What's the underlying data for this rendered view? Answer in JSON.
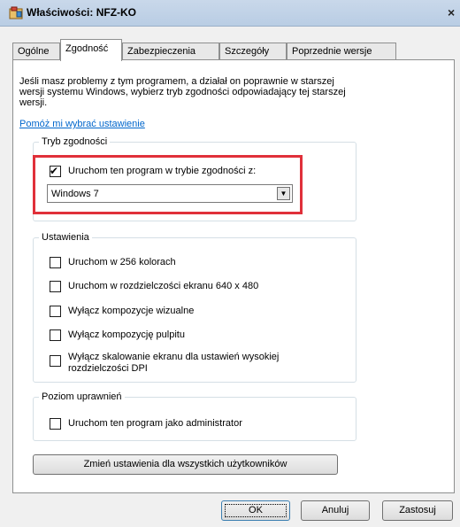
{
  "window": {
    "title": "Właściwości: NFZ-KO",
    "close_glyph": "×"
  },
  "tabs": [
    {
      "label": "Ogólne"
    },
    {
      "label": "Zgodność"
    },
    {
      "label": "Zabezpieczenia"
    },
    {
      "label": "Szczegóły"
    },
    {
      "label": "Poprzednie wersje"
    }
  ],
  "active_tab": "Zgodność",
  "description": "Jeśli masz problemy z tym programem, a działał on poprawnie w starszej wersji systemu Windows, wybierz tryb zgodności odpowiadający tej starszej wersji.",
  "help_link": "Pomóż mi wybrać ustawienie",
  "compat_mode": {
    "title": "Tryb zgodności",
    "checkbox_label": "Uruchom ten program w trybie zgodności z:",
    "checked": true,
    "select_value": "Windows 7",
    "highlight_color": "#e0303a"
  },
  "settings": {
    "title": "Ustawienia",
    "options": [
      {
        "label": "Uruchom w 256 kolorach",
        "checked": false
      },
      {
        "label": "Uruchom w rozdzielczości ekranu 640 x 480",
        "checked": false
      },
      {
        "label": "Wyłącz kompozycje wizualne",
        "checked": false
      },
      {
        "label": "Wyłącz kompozycję pulpitu",
        "checked": false
      },
      {
        "label": "Wyłącz skalowanie ekranu dla ustawień wysokiej rozdzielczości DPI",
        "checked": false
      }
    ]
  },
  "privilege": {
    "title": "Poziom uprawnień",
    "checkbox_label": "Uruchom ten program jako administrator",
    "checked": false
  },
  "change_all_button": "Zmień ustawienia dla wszystkich użytkowników",
  "buttons": {
    "ok": "OK",
    "cancel": "Anuluj",
    "apply": "Zastosuj"
  },
  "icons": {
    "title_icon": "program-properties-icon",
    "checkmark": "✔",
    "dropdown": "▼"
  }
}
